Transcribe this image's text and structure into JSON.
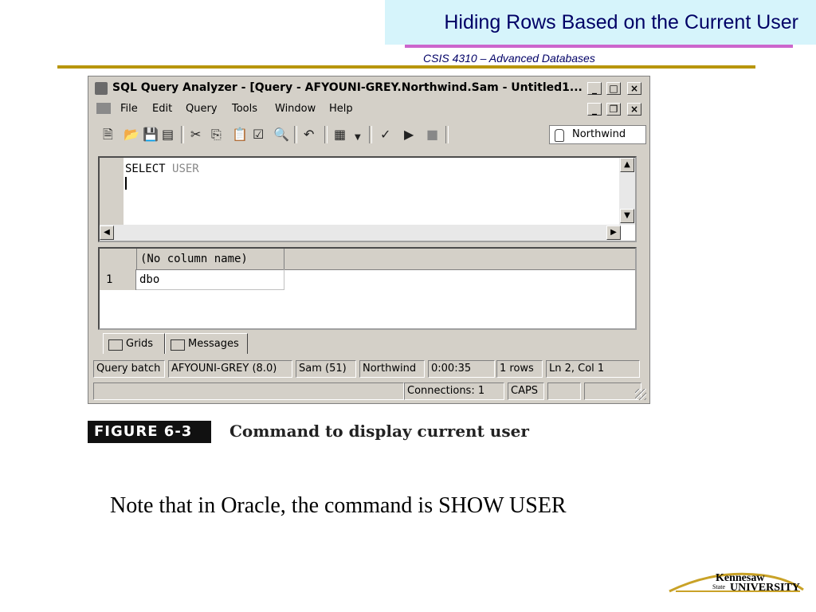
{
  "slide": {
    "title": "Hiding Rows Based on the Current User",
    "subtitle": "CSIS 4310 – Advanced Databases",
    "note": "Note that in Oracle, the command is SHOW USER"
  },
  "window": {
    "title": "SQL Query Analyzer - [Query - AFYOUNI-GREY.Northwind.Sam - Untitled1...",
    "menu": [
      "File",
      "Edit",
      "Query",
      "Tools",
      "Window",
      "Help"
    ],
    "database": "Northwind",
    "editor_keyword": "SELECT",
    "editor_function": "USER",
    "results": {
      "column_header": "(No column name)",
      "row_number": "1",
      "cell_value": "dbo"
    },
    "tabs": [
      "Grids",
      "Messages"
    ],
    "status_bar": [
      "Query batch",
      "AFYOUNI-GREY (8.0)",
      "Sam (51)",
      "Northwind",
      "0:00:35",
      "1 rows",
      "Ln 2, Col 1"
    ],
    "status_bar2": [
      "Connections: 1",
      "CAPS"
    ]
  },
  "figure": {
    "label": "FIGURE 6-3",
    "caption": "Command to display current user"
  },
  "logo": {
    "line1": "Kennesaw",
    "line2": "State",
    "line3": "UNIVERSITY"
  },
  "colors": {
    "title_bg": "#d6f4fb",
    "title_text": "#000066",
    "title_underline": "#cc66cc",
    "divider": "#b8960c",
    "logo_arc": "#c9a227"
  },
  "icons": [
    "app-icon",
    "document-icon",
    "new-query-icon",
    "open-icon",
    "save-icon",
    "cut-icon",
    "copy-icon",
    "paste-icon",
    "find-icon",
    "undo-icon",
    "grid-icon",
    "check-icon",
    "run-icon",
    "stop-icon",
    "database-icon"
  ]
}
